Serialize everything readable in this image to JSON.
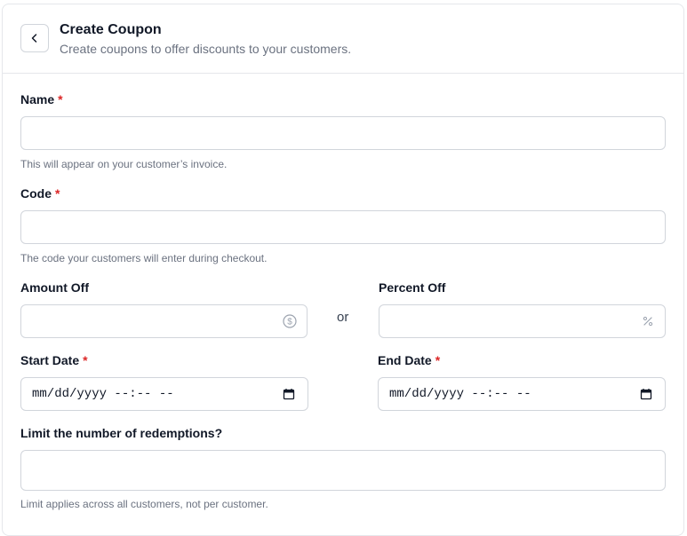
{
  "header": {
    "title": "Create Coupon",
    "subtitle": "Create coupons to offer discounts to your customers."
  },
  "form": {
    "name": {
      "label": "Name",
      "required_mark": "*",
      "value": "",
      "hint": "This will appear on your customer’s invoice."
    },
    "code": {
      "label": "Code",
      "required_mark": "*",
      "value": "",
      "hint": "The code your customers will enter during checkout."
    },
    "amount_off": {
      "label": "Amount Off",
      "value": "",
      "icon": "dollar-circle-icon"
    },
    "or_text": "or",
    "percent_off": {
      "label": "Percent Off",
      "value": "",
      "icon": "percent-icon"
    },
    "start_date": {
      "label": "Start Date",
      "required_mark": "*",
      "placeholder": "mm/dd/yyyy --:-- --",
      "icon": "calendar-icon"
    },
    "end_date": {
      "label": "End Date",
      "required_mark": "*",
      "placeholder": "mm/dd/yyyy --:-- --",
      "icon": "calendar-icon"
    },
    "redemptions": {
      "label": "Limit the number of redemptions?",
      "value": "",
      "hint": "Limit applies across all customers, not per customer."
    }
  },
  "colors": {
    "border": "#d1d5db",
    "required": "#dc2626",
    "muted": "#6b7280"
  }
}
